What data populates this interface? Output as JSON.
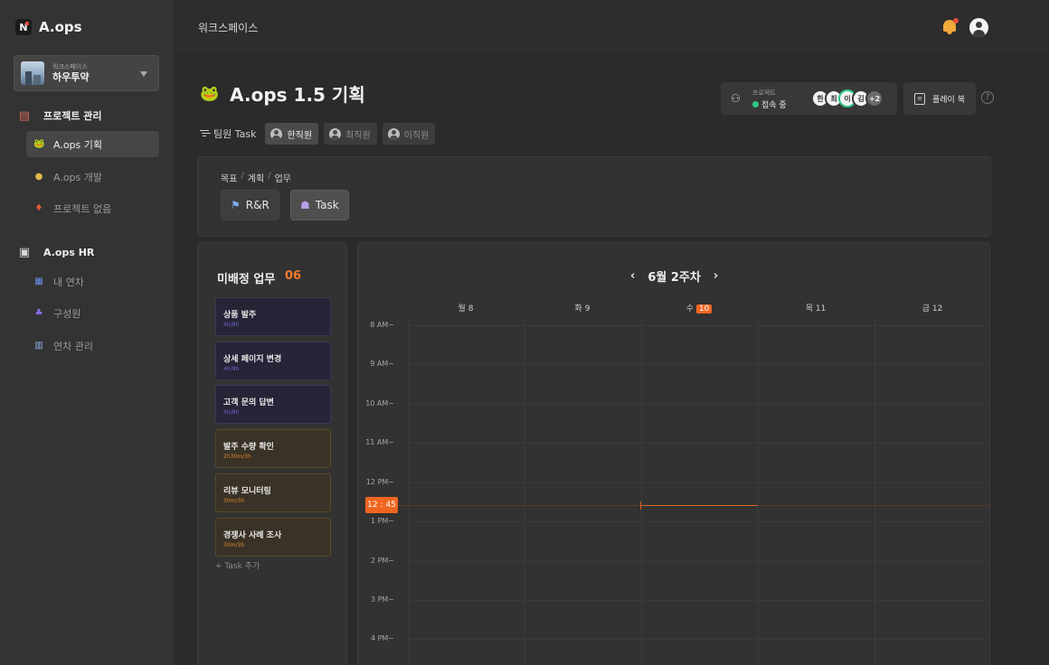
{
  "app": {
    "name": "A.ops"
  },
  "workspace": {
    "label": "워크스페이스",
    "name": "하우투약"
  },
  "sidebar": {
    "project_section": "프로젝트 관리",
    "project_items": [
      {
        "icon": "frog-icon",
        "label": "A.ops 기획",
        "active": true
      },
      {
        "icon": "pudding-icon",
        "label": "A.ops 개발",
        "active": false
      },
      {
        "icon": "fire-icon",
        "label": "프로젝트 없음",
        "active": false
      }
    ],
    "hr_section": "A.ops HR",
    "hr_items": [
      {
        "icon": "calendar-icon",
        "label": "내 연차"
      },
      {
        "icon": "people-icon",
        "label": "구성원"
      },
      {
        "icon": "building-icon",
        "label": "연차 관리"
      }
    ]
  },
  "topbar": {
    "title": "워크스페이스"
  },
  "project": {
    "title": "A.ops 1.5 기획",
    "status_label": "프로젝트",
    "status_text": "접속 중",
    "avatars": [
      "한",
      "최",
      "이",
      "김"
    ],
    "more_count": "+2",
    "playbook_label": "플레이 북",
    "help": "?"
  },
  "members": {
    "filter_label": "팀원 Task",
    "chips": [
      {
        "name": "한직원",
        "active": true
      },
      {
        "name": "최직원",
        "active": false
      },
      {
        "name": "이직원",
        "active": false
      }
    ]
  },
  "view": {
    "breadcrumb": [
      "목표",
      "계획",
      "업무"
    ],
    "buttons": [
      {
        "label": "R&R",
        "icon": "flag-icon",
        "active": false
      },
      {
        "label": "Task",
        "icon": "person-icon",
        "active": true
      }
    ]
  },
  "unassigned": {
    "title": "미배정 업무",
    "count": "06",
    "tasks": [
      {
        "title": "상품 발주",
        "meta": "4h/8h",
        "color": "purple"
      },
      {
        "title": "상세 페이지 변경",
        "meta": "4h/8h",
        "color": "purple"
      },
      {
        "title": "고객 문의 답변",
        "meta": "4h/8h",
        "color": "purple"
      },
      {
        "title": "발주 수량 확인",
        "meta": "2h30m/3h",
        "color": "gold"
      },
      {
        "title": "리뷰 모니터링",
        "meta": "30m/3h",
        "color": "gold"
      },
      {
        "title": "경쟁사 사례 조사",
        "meta": "30m/3h",
        "color": "gold"
      }
    ],
    "add_label": "+  Task 추가"
  },
  "calendar": {
    "week_label": "6월 2주차",
    "prev": "‹",
    "next": "›",
    "days": [
      {
        "dow": "월",
        "date": "8",
        "today": false
      },
      {
        "dow": "화",
        "date": "9",
        "today": false
      },
      {
        "dow": "수",
        "date": "10",
        "today": true
      },
      {
        "dow": "목",
        "date": "11",
        "today": false
      },
      {
        "dow": "금",
        "date": "12",
        "today": false
      }
    ],
    "hours": [
      "8 AM~",
      "9 AM~",
      "10 AM~",
      "11 AM~",
      "12 PM~",
      "1 PM~",
      "2 PM~",
      "3 PM~",
      "4 PM~"
    ],
    "now_label": "12 : 45"
  },
  "colors": {
    "accent": "#f0661f",
    "task_purple": "#262437",
    "task_gold": "#3a3226",
    "online": "#2fc787"
  }
}
